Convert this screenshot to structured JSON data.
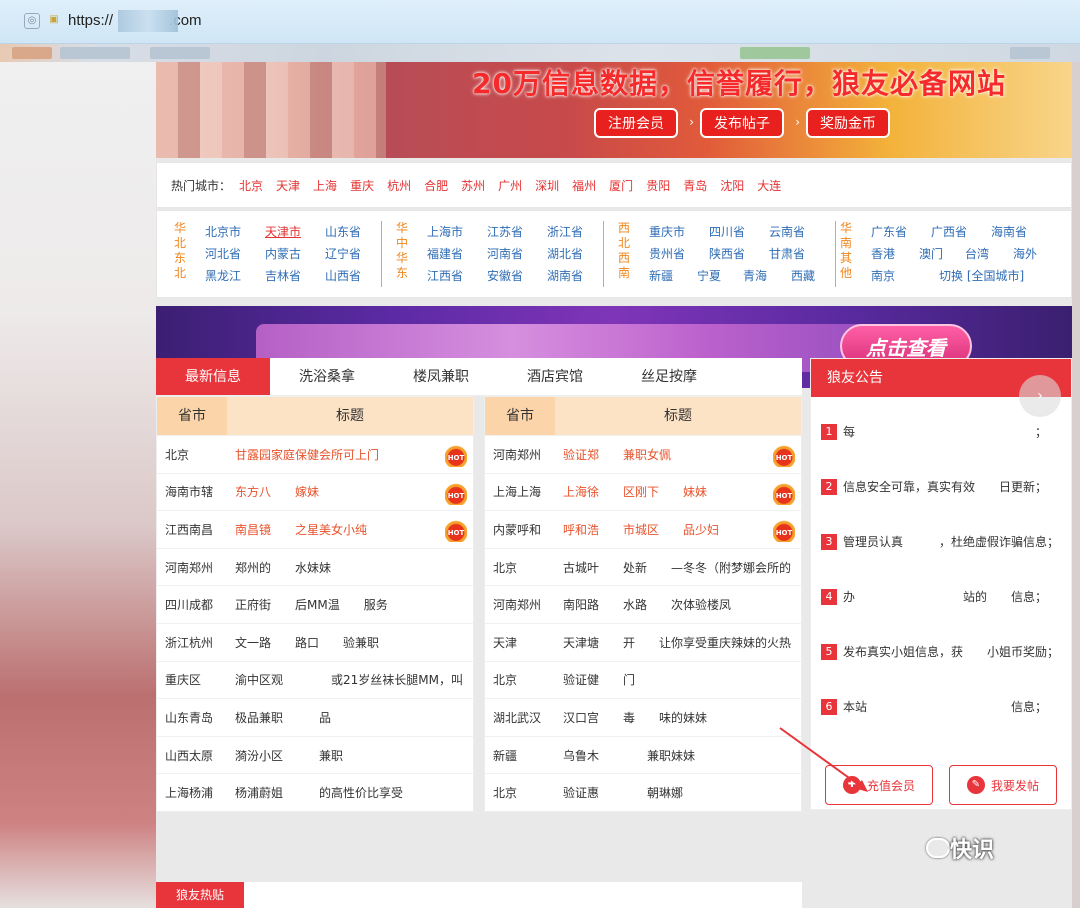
{
  "browser": {
    "url_prefix": "https://",
    "url_suffix": ".com"
  },
  "banner": {
    "slogan": "20万信息数据，信誉履行，狼友必备网站",
    "buttons": [
      "注册会员",
      "发布帖子",
      "奖励金币"
    ]
  },
  "hot_cities": {
    "label": "热门城市：",
    "cities": [
      "北京",
      "天津",
      "上海",
      "重庆",
      "杭州",
      "合肥",
      "苏州",
      "广州",
      "深圳",
      "福州",
      "厦门",
      "贵阳",
      "青岛",
      "沈阳",
      "大连"
    ]
  },
  "regions": [
    {
      "label": [
        "华",
        "北",
        "东",
        "北"
      ],
      "cities": [
        "北京市",
        "天津市",
        "山东省",
        "河北省",
        "内蒙古",
        "辽宁省",
        "黑龙江",
        "吉林省",
        "山西省"
      ],
      "active": 1
    },
    {
      "label": [
        "华",
        "中",
        "华",
        "东"
      ],
      "cities": [
        "上海市",
        "江苏省",
        "浙江省",
        "福建省",
        "河南省",
        "湖北省",
        "江西省",
        "安徽省",
        "湖南省"
      ]
    },
    {
      "label": [
        "西",
        "北",
        "西",
        "南"
      ],
      "cities": [
        "重庆市",
        "四川省",
        "云南省",
        "贵州省",
        "陕西省",
        "甘肃省",
        "新疆",
        "宁夏",
        "青海",
        "西藏"
      ]
    },
    {
      "label": [
        "华",
        "南",
        "其",
        "他"
      ],
      "cities": [
        "广东省",
        "广西省",
        "海南省",
        "香港",
        "澳门",
        "台湾",
        "海外",
        "南京",
        "切换 [全国城市]"
      ]
    }
  ],
  "promo": {
    "button": "点击查看"
  },
  "tabs": [
    "最新信息",
    "洗浴桑拿",
    "楼凤兼职",
    "酒店宾馆",
    "丝足按摩"
  ],
  "table_headers": {
    "province": "省市",
    "title": "标题"
  },
  "left_rows": [
    {
      "region": "北京",
      "title": "甘露园家庭保健会所可上门",
      "hot": true
    },
    {
      "region": "海南市辖",
      "title": "东方八　　嫁妹",
      "hot": true
    },
    {
      "region": "江西南昌",
      "title": "南昌镜　　之星美女小纯",
      "hot": true
    },
    {
      "region": "河南郑州",
      "title": "郑州的　　水妹妹",
      "hot": false
    },
    {
      "region": "四川成都",
      "title": "正府街　　后MM温　　服务",
      "hot": false
    },
    {
      "region": "浙江杭州",
      "title": "文一路　　路口　　验兼职",
      "hot": false
    },
    {
      "region": "重庆区",
      "title": "渝中区观　　　　或21岁丝袜长腿MM，叫",
      "hot": false
    },
    {
      "region": "山东青岛",
      "title": "极品兼职　　　品",
      "hot": false
    },
    {
      "region": "山西太原",
      "title": "漪汾小区　　　兼职",
      "hot": false
    },
    {
      "region": "上海杨浦",
      "title": "杨浦蔚姐　　　的高性价比享受",
      "hot": false
    }
  ],
  "right_rows": [
    {
      "region": "河南郑州",
      "title": "验证郑　　兼职女佩",
      "hot": true
    },
    {
      "region": "上海上海",
      "title": "上海徐　　区刚下　　妹妹",
      "hot": true
    },
    {
      "region": "内蒙呼和",
      "title": "呼和浩　　市城区　　品少妇",
      "hot": true
    },
    {
      "region": "北京",
      "title": "古城叶　　处新　　—冬冬（附梦娜会所的",
      "hot": false
    },
    {
      "region": "河南郑州",
      "title": "南阳路　　水路　　次体验楼凤",
      "hot": false
    },
    {
      "region": "天津",
      "title": "天津塘　　开　　让你享受重庆辣妹的火热",
      "hot": false
    },
    {
      "region": "北京",
      "title": "验证健　　门　　",
      "hot": false
    },
    {
      "region": "湖北武汉",
      "title": "汉口宫　　毒　　味的妹妹",
      "hot": false
    },
    {
      "region": "新疆",
      "title": "乌鲁木　　　　兼职妹妹",
      "hot": false
    },
    {
      "region": "北京",
      "title": "验证惠　　　　朝琳娜",
      "hot": false
    }
  ],
  "notice": {
    "title": "狼友公告",
    "items": [
      {
        "num": "1",
        "text": "每　　　　　　　　　　　　　　　；"
      },
      {
        "num": "2",
        "text": "信息安全可靠，真实有效　　日更新；"
      },
      {
        "num": "3",
        "text": "管理员认真　　　，杜绝虚假诈骗信息；"
      },
      {
        "num": "4",
        "text": "办　　　　　　　　　站的　　信息；"
      },
      {
        "num": "5",
        "text": "发布真实小姐信息，获　　小姐币奖励；"
      },
      {
        "num": "6",
        "text": "本站　　　　　　　　　　　　信息；"
      }
    ],
    "buttons": [
      "充值会员",
      "我要发帖"
    ]
  },
  "hot_posts": {
    "label": "狼友热贴"
  },
  "watermark": "快识"
}
